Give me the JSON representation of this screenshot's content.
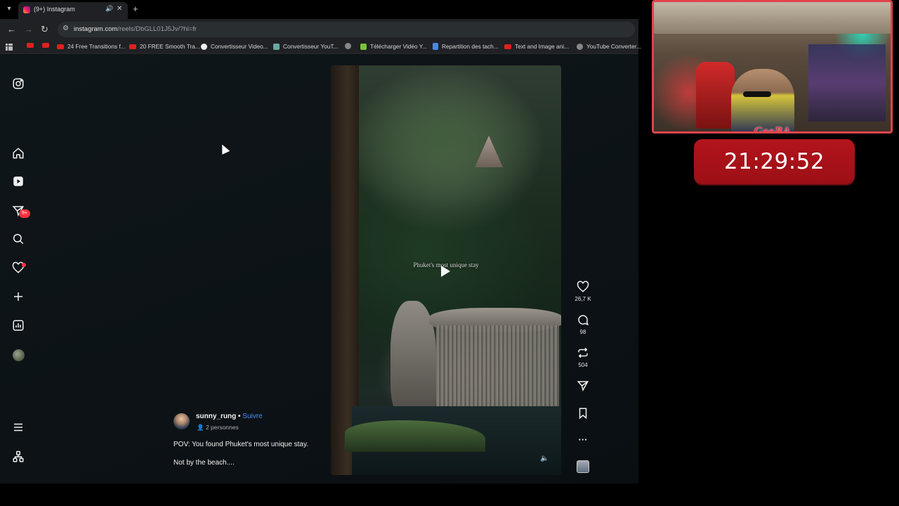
{
  "browser": {
    "tab": {
      "title": "(9+) Instagram"
    },
    "url": {
      "host": "instagram.com",
      "path": "/reels/DbGLL01J5Jv/?hl=fr"
    },
    "bookmarks": [
      {
        "label": "",
        "icon": "youtube-icon"
      },
      {
        "label": "",
        "icon": "youtube-icon"
      },
      {
        "label": "24 Free Transitions f...",
        "icon": "youtube-icon"
      },
      {
        "label": "20 FREE Smooth Tra...",
        "icon": "youtube-icon"
      },
      {
        "label": "Convertisseur Video...",
        "icon": "google-icon"
      },
      {
        "label": "Convertisseur YouT...",
        "icon": "converter-icon"
      },
      {
        "label": "",
        "icon": "globe-icon"
      },
      {
        "label": "Télécharger Vidéo Y...",
        "icon": "download-icon"
      },
      {
        "label": "Repartition des tach...",
        "icon": "docs-icon"
      },
      {
        "label": "Text and Image ani...",
        "icon": "youtube-icon"
      },
      {
        "label": "YouTube Converter...",
        "icon": "globe-icon"
      }
    ]
  },
  "sidebar": {
    "items": [
      {
        "name": "instagram-logo-icon"
      },
      {
        "name": "home-icon"
      },
      {
        "name": "reels-icon"
      },
      {
        "name": "messages-icon",
        "badge": "9+"
      },
      {
        "name": "search-icon"
      },
      {
        "name": "notifications-icon"
      },
      {
        "name": "create-icon"
      },
      {
        "name": "dashboard-icon"
      },
      {
        "name": "profile-avatar"
      },
      {
        "name": "menu-icon"
      },
      {
        "name": "more-apps-icon"
      }
    ]
  },
  "reel": {
    "overlay_text": "Phuket's most unique stay",
    "likes": "26,7 K",
    "comments": "98",
    "reposts": "504"
  },
  "post": {
    "username": "sunny_rung",
    "separator": " • ",
    "follow": "Suivre",
    "collab": "2 personnes",
    "caption_line1": "POV: You found Phuket's most unique stay.",
    "caption_line2": "Not by the beach...."
  },
  "stream_overlay": {
    "name": "GooBA",
    "clock": "21:29:52"
  },
  "colors": {
    "accent_blue": "#4c8ff6",
    "badge_red": "#ff3040",
    "clock_red": "#b3141c"
  }
}
